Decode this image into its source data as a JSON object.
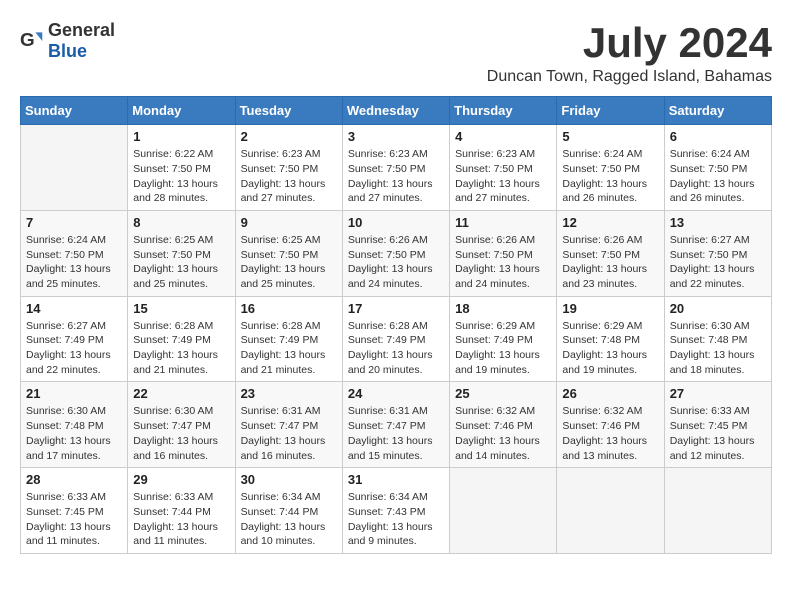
{
  "logo": {
    "text_general": "General",
    "text_blue": "Blue"
  },
  "title": "July 2024",
  "location": "Duncan Town, Ragged Island, Bahamas",
  "days_of_week": [
    "Sunday",
    "Monday",
    "Tuesday",
    "Wednesday",
    "Thursday",
    "Friday",
    "Saturday"
  ],
  "weeks": [
    [
      {
        "day": "",
        "info": ""
      },
      {
        "day": "1",
        "info": "Sunrise: 6:22 AM\nSunset: 7:50 PM\nDaylight: 13 hours\nand 28 minutes."
      },
      {
        "day": "2",
        "info": "Sunrise: 6:23 AM\nSunset: 7:50 PM\nDaylight: 13 hours\nand 27 minutes."
      },
      {
        "day": "3",
        "info": "Sunrise: 6:23 AM\nSunset: 7:50 PM\nDaylight: 13 hours\nand 27 minutes."
      },
      {
        "day": "4",
        "info": "Sunrise: 6:23 AM\nSunset: 7:50 PM\nDaylight: 13 hours\nand 27 minutes."
      },
      {
        "day": "5",
        "info": "Sunrise: 6:24 AM\nSunset: 7:50 PM\nDaylight: 13 hours\nand 26 minutes."
      },
      {
        "day": "6",
        "info": "Sunrise: 6:24 AM\nSunset: 7:50 PM\nDaylight: 13 hours\nand 26 minutes."
      }
    ],
    [
      {
        "day": "7",
        "info": "Sunrise: 6:24 AM\nSunset: 7:50 PM\nDaylight: 13 hours\nand 25 minutes."
      },
      {
        "day": "8",
        "info": "Sunrise: 6:25 AM\nSunset: 7:50 PM\nDaylight: 13 hours\nand 25 minutes."
      },
      {
        "day": "9",
        "info": "Sunrise: 6:25 AM\nSunset: 7:50 PM\nDaylight: 13 hours\nand 25 minutes."
      },
      {
        "day": "10",
        "info": "Sunrise: 6:26 AM\nSunset: 7:50 PM\nDaylight: 13 hours\nand 24 minutes."
      },
      {
        "day": "11",
        "info": "Sunrise: 6:26 AM\nSunset: 7:50 PM\nDaylight: 13 hours\nand 24 minutes."
      },
      {
        "day": "12",
        "info": "Sunrise: 6:26 AM\nSunset: 7:50 PM\nDaylight: 13 hours\nand 23 minutes."
      },
      {
        "day": "13",
        "info": "Sunrise: 6:27 AM\nSunset: 7:50 PM\nDaylight: 13 hours\nand 22 minutes."
      }
    ],
    [
      {
        "day": "14",
        "info": "Sunrise: 6:27 AM\nSunset: 7:49 PM\nDaylight: 13 hours\nand 22 minutes."
      },
      {
        "day": "15",
        "info": "Sunrise: 6:28 AM\nSunset: 7:49 PM\nDaylight: 13 hours\nand 21 minutes."
      },
      {
        "day": "16",
        "info": "Sunrise: 6:28 AM\nSunset: 7:49 PM\nDaylight: 13 hours\nand 21 minutes."
      },
      {
        "day": "17",
        "info": "Sunrise: 6:28 AM\nSunset: 7:49 PM\nDaylight: 13 hours\nand 20 minutes."
      },
      {
        "day": "18",
        "info": "Sunrise: 6:29 AM\nSunset: 7:49 PM\nDaylight: 13 hours\nand 19 minutes."
      },
      {
        "day": "19",
        "info": "Sunrise: 6:29 AM\nSunset: 7:48 PM\nDaylight: 13 hours\nand 19 minutes."
      },
      {
        "day": "20",
        "info": "Sunrise: 6:30 AM\nSunset: 7:48 PM\nDaylight: 13 hours\nand 18 minutes."
      }
    ],
    [
      {
        "day": "21",
        "info": "Sunrise: 6:30 AM\nSunset: 7:48 PM\nDaylight: 13 hours\nand 17 minutes."
      },
      {
        "day": "22",
        "info": "Sunrise: 6:30 AM\nSunset: 7:47 PM\nDaylight: 13 hours\nand 16 minutes."
      },
      {
        "day": "23",
        "info": "Sunrise: 6:31 AM\nSunset: 7:47 PM\nDaylight: 13 hours\nand 16 minutes."
      },
      {
        "day": "24",
        "info": "Sunrise: 6:31 AM\nSunset: 7:47 PM\nDaylight: 13 hours\nand 15 minutes."
      },
      {
        "day": "25",
        "info": "Sunrise: 6:32 AM\nSunset: 7:46 PM\nDaylight: 13 hours\nand 14 minutes."
      },
      {
        "day": "26",
        "info": "Sunrise: 6:32 AM\nSunset: 7:46 PM\nDaylight: 13 hours\nand 13 minutes."
      },
      {
        "day": "27",
        "info": "Sunrise: 6:33 AM\nSunset: 7:45 PM\nDaylight: 13 hours\nand 12 minutes."
      }
    ],
    [
      {
        "day": "28",
        "info": "Sunrise: 6:33 AM\nSunset: 7:45 PM\nDaylight: 13 hours\nand 11 minutes."
      },
      {
        "day": "29",
        "info": "Sunrise: 6:33 AM\nSunset: 7:44 PM\nDaylight: 13 hours\nand 11 minutes."
      },
      {
        "day": "30",
        "info": "Sunrise: 6:34 AM\nSunset: 7:44 PM\nDaylight: 13 hours\nand 10 minutes."
      },
      {
        "day": "31",
        "info": "Sunrise: 6:34 AM\nSunset: 7:43 PM\nDaylight: 13 hours\nand 9 minutes."
      },
      {
        "day": "",
        "info": ""
      },
      {
        "day": "",
        "info": ""
      },
      {
        "day": "",
        "info": ""
      }
    ]
  ]
}
